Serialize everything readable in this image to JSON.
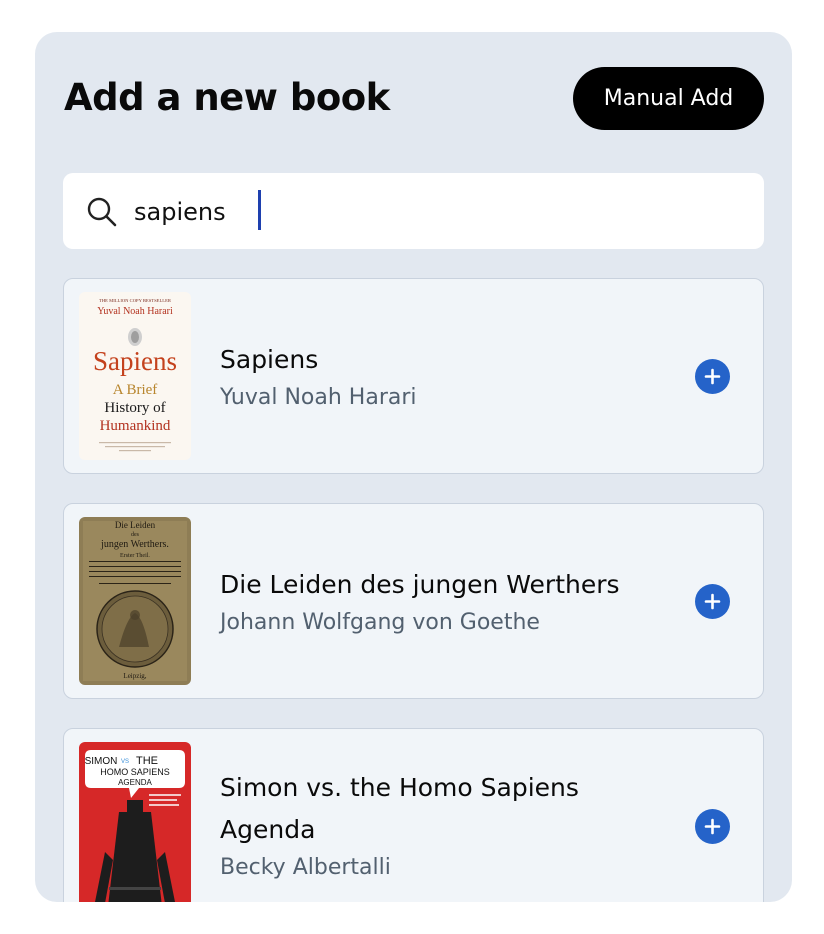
{
  "header": {
    "title": "Add a new book",
    "manual_add_label": "Manual Add"
  },
  "search": {
    "value": "sapiens",
    "icon": "search-icon"
  },
  "results": [
    {
      "title": "Sapiens",
      "author": "Yuval Noah Harari",
      "cover": {
        "top_line": "THE MILLION COPY BESTSELLER",
        "author": "Yuval Noah Harari",
        "title": "Sapiens",
        "subtitle_1": "A Brief",
        "subtitle_2": "History of",
        "subtitle_3": "Humankind"
      }
    },
    {
      "title": "Die Leiden des jungen Werthers",
      "author": "Johann Wolfgang von Goethe",
      "cover": {
        "line_1": "Die Leiden",
        "line_2": "des",
        "line_3": "jungen Werthers.",
        "line_4": "Erster Theil.",
        "footer": "Leipzig,"
      }
    },
    {
      "title_line_1": "Simon vs. the Homo Sapiens",
      "title_line_2": "Agenda",
      "author": "Becky Albertalli",
      "cover": {
        "line_1": "SIMON",
        "vs": "VS",
        "line_1b": "THE",
        "line_2": "HOMO SAPIENS",
        "line_3": "AGENDA"
      }
    }
  ],
  "colors": {
    "panel_bg": "#e2e8f0",
    "card_bg": "#f1f5f9",
    "accent": "#2563c9",
    "caret": "#1e40af"
  }
}
